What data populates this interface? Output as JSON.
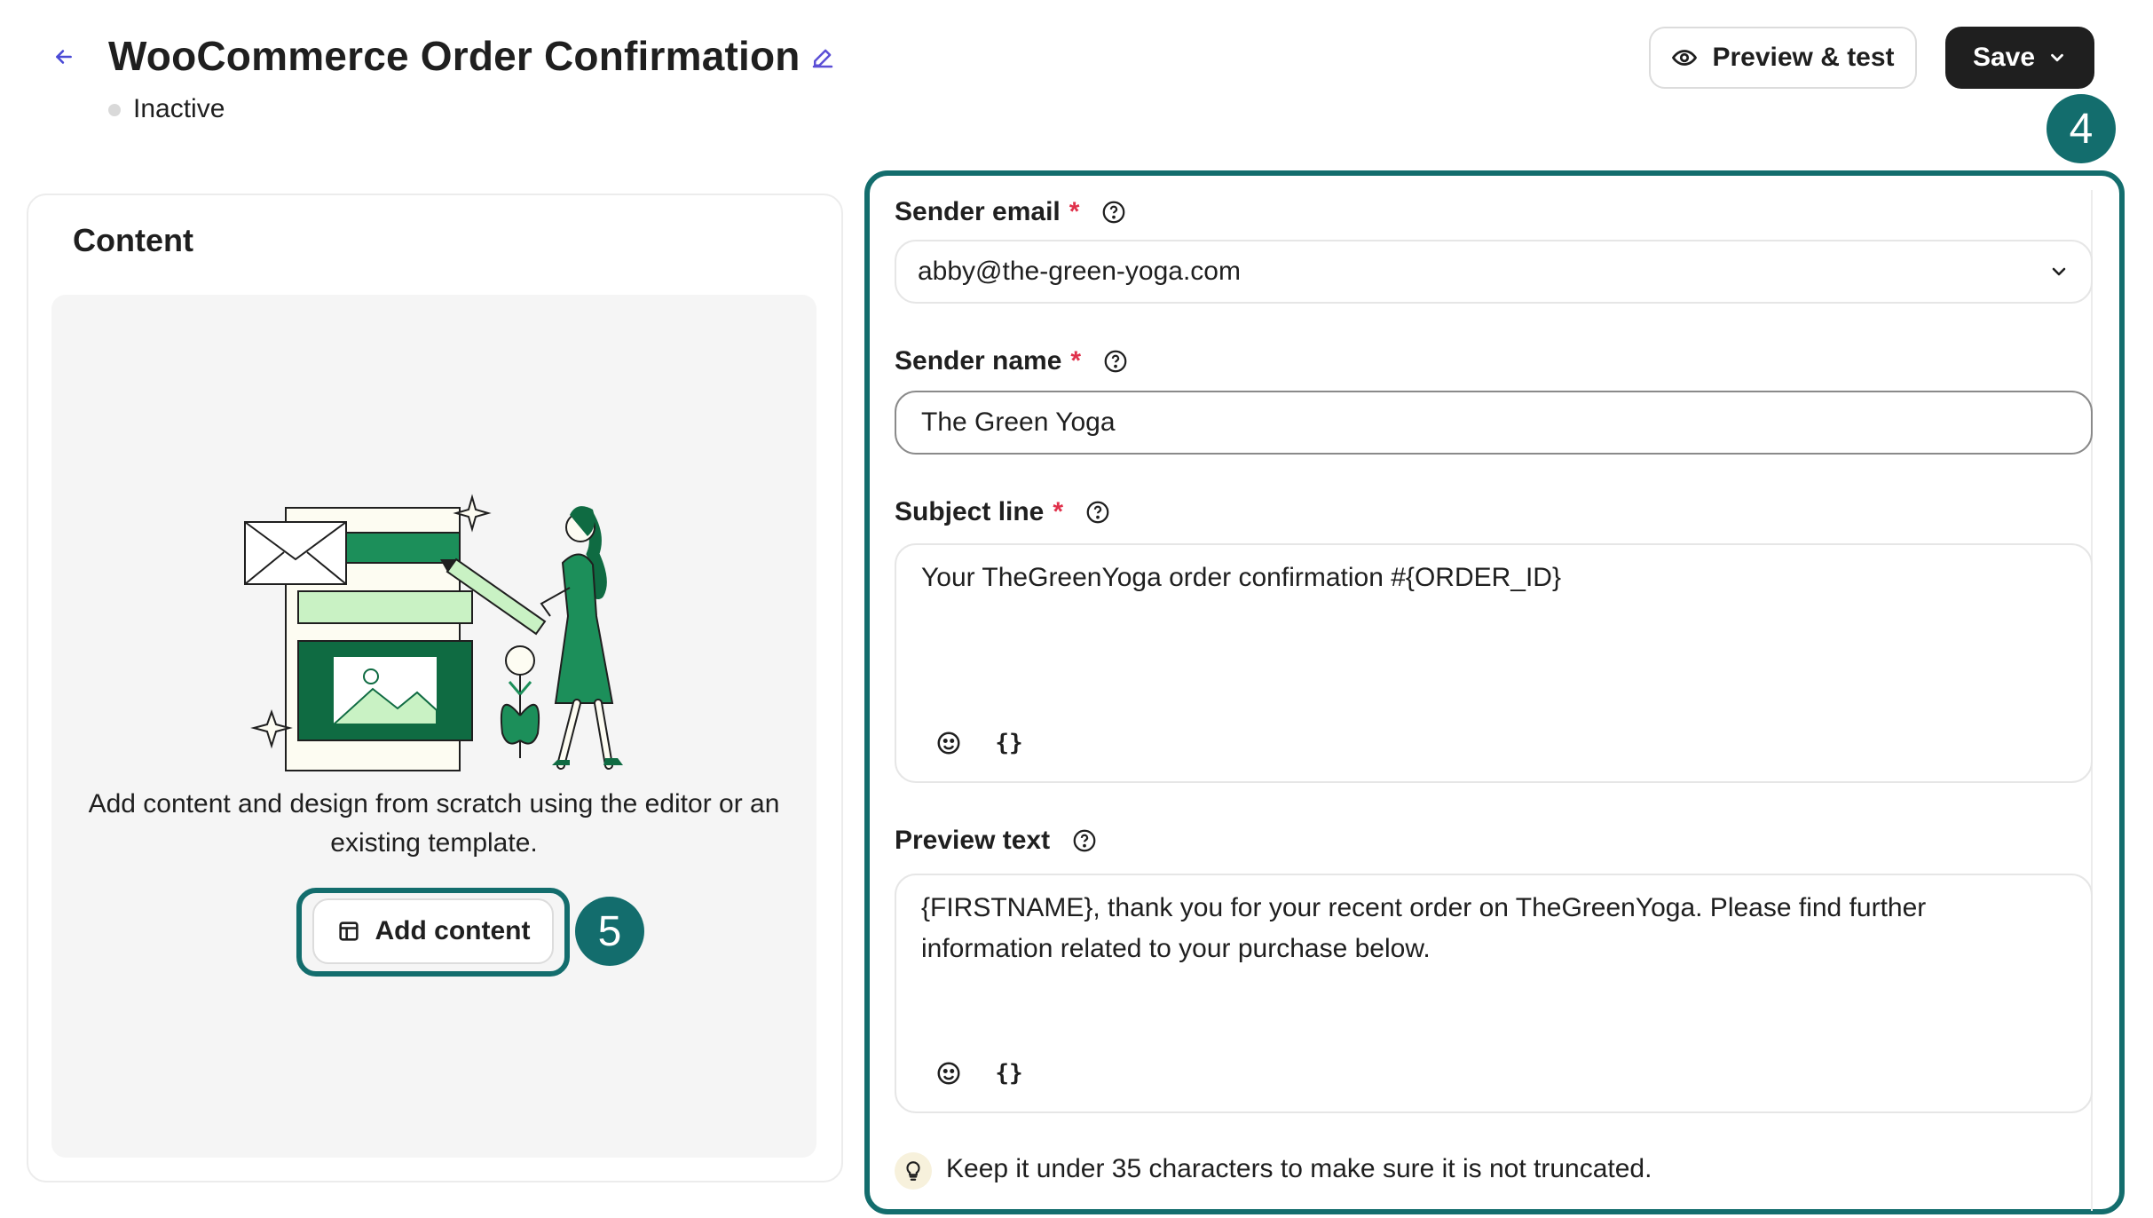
{
  "header": {
    "title": "WooCommerce Order Confirmation",
    "status": "Inactive",
    "preview_label": "Preview & test",
    "save_label": "Save",
    "icons": {
      "back": "arrow-left-icon",
      "edit": "pencil-icon",
      "preview": "eye-icon",
      "save_menu": "chevron-down-icon"
    }
  },
  "callouts": {
    "form_step": "4",
    "content_step": "5"
  },
  "content": {
    "title": "Content",
    "description": "Add content and design from scratch using the editor or an existing template.",
    "add_label": "Add content",
    "add_icon": "layout-icon"
  },
  "form": {
    "sender_email": {
      "label": "Sender email",
      "required_mark": "*",
      "value": "abby@the-green-yoga.com"
    },
    "sender_name": {
      "label": "Sender name",
      "required_mark": "*",
      "value": "The Green Yoga"
    },
    "subject_line": {
      "label": "Subject line",
      "required_mark": "*",
      "value": "Your TheGreenYoga order confirmation #{ORDER_ID}",
      "tool_emoji": "smiley-icon",
      "tool_variable": "{}"
    },
    "preview_text": {
      "label": "Preview text",
      "value": "{FIRSTNAME}, thank you for your recent order on TheGreenYoga. Please find further information related to your purchase below.",
      "tool_emoji": "smiley-icon",
      "tool_variable": "{}"
    },
    "tip": "Keep it under 35 characters to make sure it is not truncated."
  },
  "colors": {
    "accent_teal": "#136d6d",
    "brand_green": "#0f7a4a",
    "light_green": "#c9f2c4",
    "required_red": "#e0314b",
    "save_bg": "#1f1f1f",
    "edit_icon": "#5b4fd6"
  }
}
